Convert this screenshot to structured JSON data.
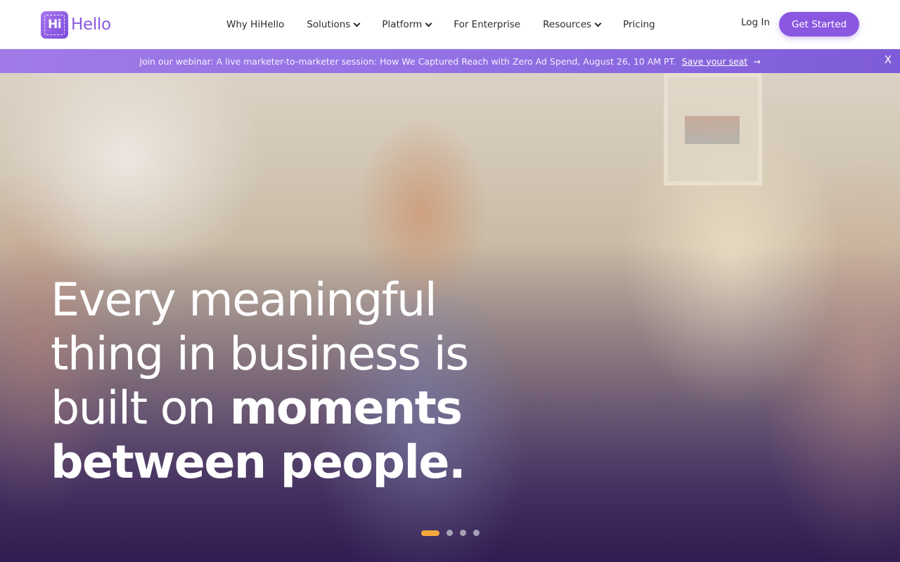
{
  "header": {
    "logo_badge": "Hi",
    "logo_text": "Hello",
    "nav": [
      {
        "label": "Why HiHello",
        "dropdown": false
      },
      {
        "label": "Solutions",
        "dropdown": true
      },
      {
        "label": "Platform",
        "dropdown": true
      },
      {
        "label": "For Enterprise",
        "dropdown": false
      },
      {
        "label": "Resources",
        "dropdown": true
      },
      {
        "label": "Pricing",
        "dropdown": false
      }
    ],
    "login_label": "Log In",
    "cta_label": "Get Started"
  },
  "banner": {
    "text": "Join our webinar: A live marketer-to-marketer session: How We Captured Reach with Zero Ad Spend, August 26, 10 AM PT.",
    "link_label": "Save your seat",
    "arrow": "→",
    "close_label": "X"
  },
  "hero": {
    "headline_line1": "Every meaningful",
    "headline_line2": "thing in business is",
    "headline_line3_light": "built on",
    "headline_line3_bold": "moments",
    "headline_line4_bold": "between people.",
    "slide_count": 4,
    "active_slide": 1
  },
  "colors": {
    "brand_purple": "#8a57e0",
    "banner_purple": "#9371e5",
    "active_dot": "#f5a83a"
  }
}
